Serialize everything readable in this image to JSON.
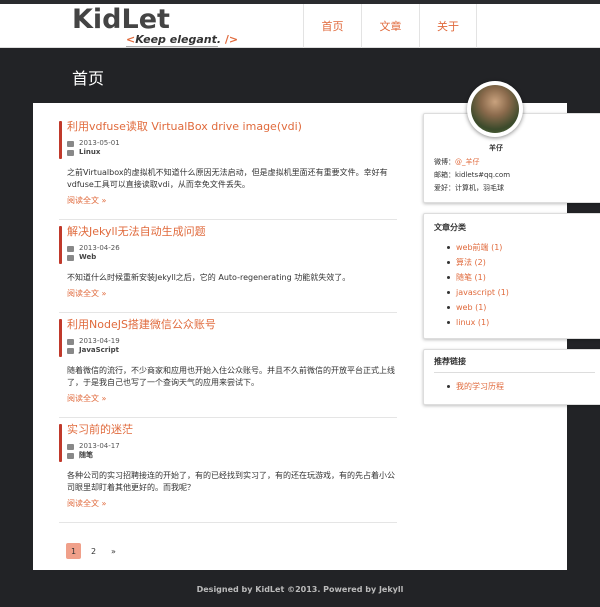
{
  "site": {
    "logo_title": "KidLet",
    "logo_tagline_open": "<",
    "logo_tagline_text": "Keep elegant.",
    "logo_tagline_close": "/>"
  },
  "nav": {
    "items": [
      {
        "label": "首页"
      },
      {
        "label": "文章"
      },
      {
        "label": "关于"
      }
    ]
  },
  "page": {
    "title": "首页"
  },
  "posts": [
    {
      "title": "利用vdfuse读取 VirtualBox drive image(vdi)",
      "date": "2013-05-01",
      "category": "Linux",
      "summary": "之前Virtualbox的虚拟机不知道什么原因无法启动，但是虚拟机里面还有重要文件。幸好有vdfuse工具可以直接读取vdi，从而幸免文件丢失。",
      "read_more": "阅读全文 »"
    },
    {
      "title": "解决Jekyll无法自动生成问题",
      "date": "2013-04-26",
      "category": "Web",
      "summary": "不知道什么时候重新安装Jekyll之后，它的 Auto-regenerating 功能就失效了。",
      "read_more": "阅读全文 »"
    },
    {
      "title": "利用NodeJS搭建微信公众账号",
      "date": "2013-04-19",
      "category": "JavaScript",
      "summary": "随着微信的流行，不少商家和应用也开始入住公众账号。并且不久前微信的开放平台正式上线了，于是我自己也写了一个查询天气的应用来尝试下。",
      "read_more": "阅读全文 »"
    },
    {
      "title": "实习前的迷茫",
      "date": "2013-04-17",
      "category": "随笔",
      "summary": "各种公司的实习招聘接连的开始了，有的已经找到实习了，有的还在玩游戏，有的先占着小公司眼里却盯着其他更好的。而我呢？",
      "read_more": "阅读全文 »"
    }
  ],
  "pager": {
    "pages": [
      "1",
      "2"
    ],
    "next": "»",
    "active": "1"
  },
  "profile": {
    "name": "羊仔",
    "weibo_label": "微博：",
    "weibo_value": "@_羊仔",
    "email_label": "邮箱：",
    "email_value": "kidlets#qq.com",
    "hobby_label": "爱好：",
    "hobby_value": "计算机，羽毛球"
  },
  "categories": {
    "title": "文章分类",
    "items": [
      {
        "label": "web前端 (1)"
      },
      {
        "label": "算法 (2)"
      },
      {
        "label": "随笔 (1)"
      },
      {
        "label": "javascript (1)"
      },
      {
        "label": "web (1)"
      },
      {
        "label": "linux (1)"
      }
    ]
  },
  "links": {
    "title": "推荐链接",
    "items": [
      {
        "label": "我的学习历程"
      }
    ]
  },
  "footer": {
    "text": "Designed by KidLet ©2013. Powered by Jekyll"
  },
  "colors": {
    "accent": "#e06a3c",
    "post_bar": "#c0392b",
    "background": "#222326"
  },
  "icons": {
    "date": "calendar-icon",
    "category": "folder-icon"
  }
}
